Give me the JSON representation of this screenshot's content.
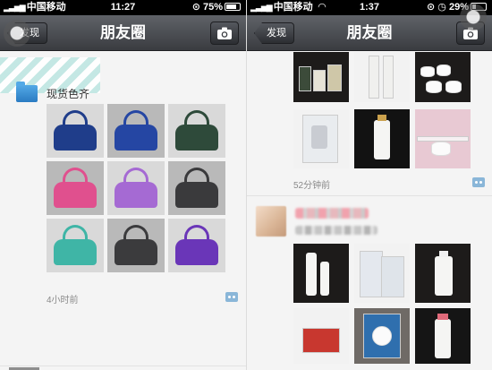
{
  "left": {
    "status": {
      "carrier": "中国移动",
      "time": "11:27",
      "battery": "75%"
    },
    "nav": {
      "back_label": "发现",
      "title": "朋友圈"
    },
    "post": {
      "text": "现货色齐",
      "time_ago": "4小时前"
    }
  },
  "right": {
    "status": {
      "carrier": "中国移动",
      "time": "1:37",
      "battery": "29%"
    },
    "nav": {
      "back_label": "发现",
      "title": "朋友圈"
    },
    "post1": {
      "time_ago": "52分钟前"
    }
  },
  "icons": {
    "signal": "signal-bars-icon",
    "wifi": "wifi-icon",
    "lock": "rotation-lock-icon",
    "battery": "battery-icon",
    "camera": "camera-icon",
    "comment": "comment-icon",
    "assistive": "assistive-touch-icon"
  },
  "colors": {
    "navbar_top": "#5f6268",
    "navbar_bottom": "#3a3c40",
    "feed_bg": "#f4f4f4",
    "folder_avatar": "#2a7bc2"
  },
  "bag_colors": [
    "#1f3d8a",
    "#2546a3",
    "#2e4a3a",
    "#e0508e",
    "#a56ad3",
    "#3a3a3c",
    "#3fb5a6",
    "#3b3b3d",
    "#6a36b8"
  ]
}
